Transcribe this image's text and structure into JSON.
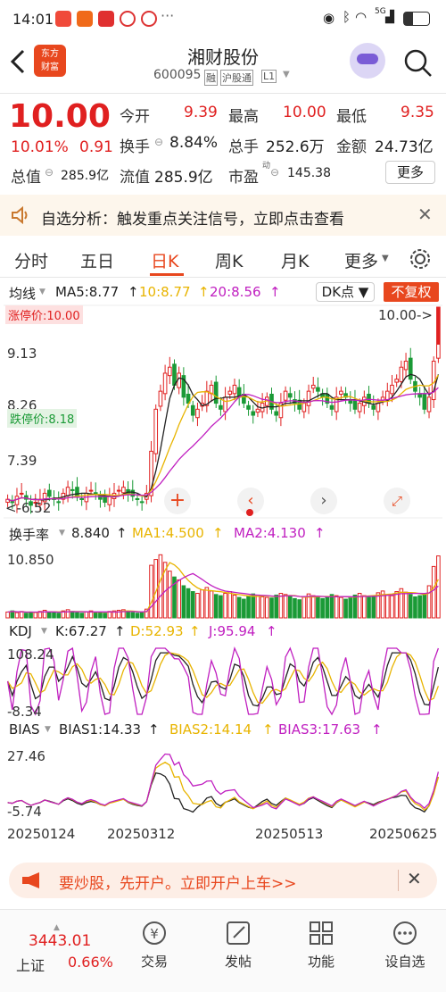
{
  "status": {
    "time": "14:01",
    "signal": "5G",
    "battery": "36"
  },
  "header": {
    "title": "湘财股份",
    "code": "600095",
    "tags": [
      "融",
      "沪股通",
      "L1"
    ],
    "logo_line1": "东方",
    "logo_line2": "财富"
  },
  "quote": {
    "price": "10.00",
    "change_pct": "10.01%",
    "change": "0.91",
    "open_label": "今开",
    "open": "9.39",
    "high_label": "最高",
    "high": "10.00",
    "low_label": "最低",
    "low": "9.35",
    "turnover_label": "换手",
    "turnover": "8.84%",
    "volume_label": "总手",
    "volume": "252.6万",
    "amount_label": "金额",
    "amount": "24.73亿",
    "mcap_label": "总值",
    "mcap": "285.9亿",
    "float_label": "流值",
    "float": "285.9亿",
    "pe_label": "市盈",
    "pe_sup": "动",
    "pe": "145.38",
    "more": "更多"
  },
  "notice": {
    "text": "自选分析：触发重点关注信号，立即点击查看"
  },
  "tabs": [
    "分时",
    "五日",
    "日K",
    "周K",
    "月K",
    "更多"
  ],
  "active_tab": "日K",
  "ma_bar": {
    "title": "均线",
    "ma5": "MA5:8.77",
    "ma10": "10:8.77",
    "ma20": "20:8.56",
    "dk": "DK点",
    "fq": "不复权"
  },
  "main_chart": {
    "ymax": "9.13",
    "ymid": "8.26",
    "ymin": "7.39",
    "limit_up": "涨停价:10.00",
    "limit_down": "跌停价:8.18",
    "last": "10.00",
    "low_mark": "6.52",
    "low_axis": "6.52"
  },
  "turnover_chart": {
    "title": "换手率",
    "value": "8.840",
    "ma1": "MA1:4.500",
    "ma2": "MA2:4.130",
    "max": "10.850"
  },
  "kdj_chart": {
    "title": "KDJ",
    "k": "K:67.27",
    "d": "D:52.93",
    "j": "J:95.94",
    "max": "108.24",
    "min": "-8.34"
  },
  "bias_chart": {
    "title": "BIAS",
    "b1": "BIAS1:14.33",
    "b2": "BIAS2:14.14",
    "b3": "BIAS3:17.63",
    "max": "27.46",
    "min": "-5.74"
  },
  "dates": [
    "20250124",
    "20250312",
    "20250513",
    "20250625"
  ],
  "banner": {
    "text": "要炒股，先开户。立即开户上车>>"
  },
  "bottom": {
    "index_value": "3443.01",
    "index_name": "上证",
    "index_pct": "0.66%",
    "nav": [
      "交易",
      "发帖",
      "功能",
      "设自选"
    ]
  },
  "colors": {
    "up": "#e02020",
    "down": "#1a9a36",
    "ma5": "#222222",
    "ma10": "#e8b400",
    "ma20": "#c01fc0"
  },
  "chart_data": {
    "type": "candlestick",
    "closes": [
      6.8,
      6.75,
      6.85,
      6.9,
      6.8,
      6.7,
      6.75,
      6.8,
      6.9,
      6.85,
      6.8,
      6.75,
      6.9,
      7.0,
      6.95,
      6.85,
      6.8,
      6.9,
      6.95,
      6.9,
      6.8,
      6.75,
      6.85,
      6.9,
      6.95,
      7.0,
      6.9,
      6.85,
      6.8,
      6.75,
      6.9,
      7.6,
      8.3,
      8.6,
      8.9,
      9.0,
      8.7,
      8.9,
      8.5,
      8.4,
      8.2,
      8.3,
      8.4,
      8.6,
      8.7,
      8.4,
      8.3,
      8.5,
      8.6,
      8.7,
      8.5,
      8.4,
      8.3,
      8.2,
      8.3,
      8.4,
      8.5,
      8.3,
      8.2,
      8.4,
      8.6,
      8.5,
      8.4,
      8.3,
      8.4,
      8.6,
      8.7,
      8.6,
      8.5,
      8.4,
      8.3,
      8.5,
      8.6,
      8.5,
      8.4,
      8.3,
      8.4,
      8.5,
      8.4,
      8.3,
      8.4,
      8.5,
      8.6,
      8.7,
      8.8,
      9.0,
      9.1,
      8.8,
      8.6,
      8.5,
      8.3,
      8.5,
      9.1,
      10.0
    ],
    "turnover": [
      1.0,
      1.2,
      0.9,
      1.1,
      0.8,
      1.0,
      0.9,
      1.1,
      1.3,
      1.0,
      0.9,
      0.8,
      1.2,
      1.4,
      1.1,
      0.9,
      0.8,
      1.0,
      1.2,
      1.0,
      0.9,
      0.8,
      1.1,
      1.2,
      1.3,
      1.4,
      1.0,
      0.9,
      0.8,
      0.9,
      1.5,
      9.0,
      10.0,
      10.8,
      9.5,
      8.0,
      7.0,
      6.5,
      5.5,
      5.0,
      4.5,
      4.2,
      4.8,
      5.2,
      4.6,
      4.0,
      3.8,
      4.2,
      4.5,
      3.9,
      3.5,
      3.2,
      3.8,
      4.1,
      3.9,
      3.6,
      3.5,
      3.4,
      3.9,
      4.2,
      4.0,
      3.7,
      3.3,
      3.1,
      3.6,
      4.1,
      3.8,
      3.5,
      3.3,
      3.6,
      4.0,
      3.8,
      3.5,
      3.2,
      3.4,
      3.9,
      4.2,
      3.8,
      3.5,
      3.7,
      4.3,
      4.6,
      4.0,
      3.8,
      4.5,
      5.0,
      4.4,
      4.0,
      3.6,
      3.8,
      4.2,
      5.5,
      8.8,
      10.6
    ],
    "ylim": [
      6.52,
      10.0
    ]
  }
}
